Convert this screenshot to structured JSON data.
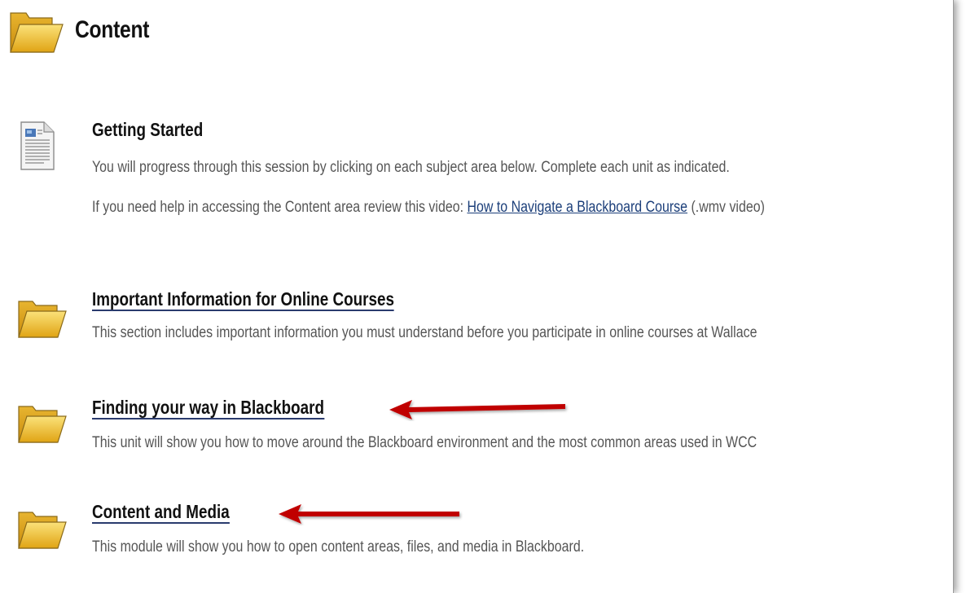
{
  "header": {
    "title": "Content",
    "icon": "folder-icon"
  },
  "items": [
    {
      "title": "Getting Started",
      "icon": "document-icon",
      "is_link": false,
      "desc1": "You will progress through this session by clicking on each subject area below. Complete each unit as indicated.",
      "desc2_prefix": "If you need help in accessing the Content area review this video: ",
      "desc2_link": "How to Navigate a Blackboard Course",
      "desc2_suffix": " (.wmv video)"
    },
    {
      "title": "Important Information for Online Courses",
      "icon": "folder-icon",
      "is_link": true,
      "desc1": "This section includes important information you must understand before you participate in online courses at Wallace"
    },
    {
      "title": "Finding your way in Blackboard",
      "icon": "folder-icon",
      "is_link": true,
      "desc1": "This unit will show you how to move around the Blackboard environment and the most common areas used in WCC",
      "annotation": "red-arrow"
    },
    {
      "title": "Content and Media",
      "icon": "folder-icon",
      "is_link": true,
      "desc1": "This module will show you how to open content areas, files, and media in Blackboard.",
      "annotation": "red-arrow"
    }
  ],
  "colors": {
    "link_underline": "#2a3b6e",
    "link_text": "#1c3f7a",
    "arrow": "#c00000",
    "folder": "#f2c12e"
  }
}
